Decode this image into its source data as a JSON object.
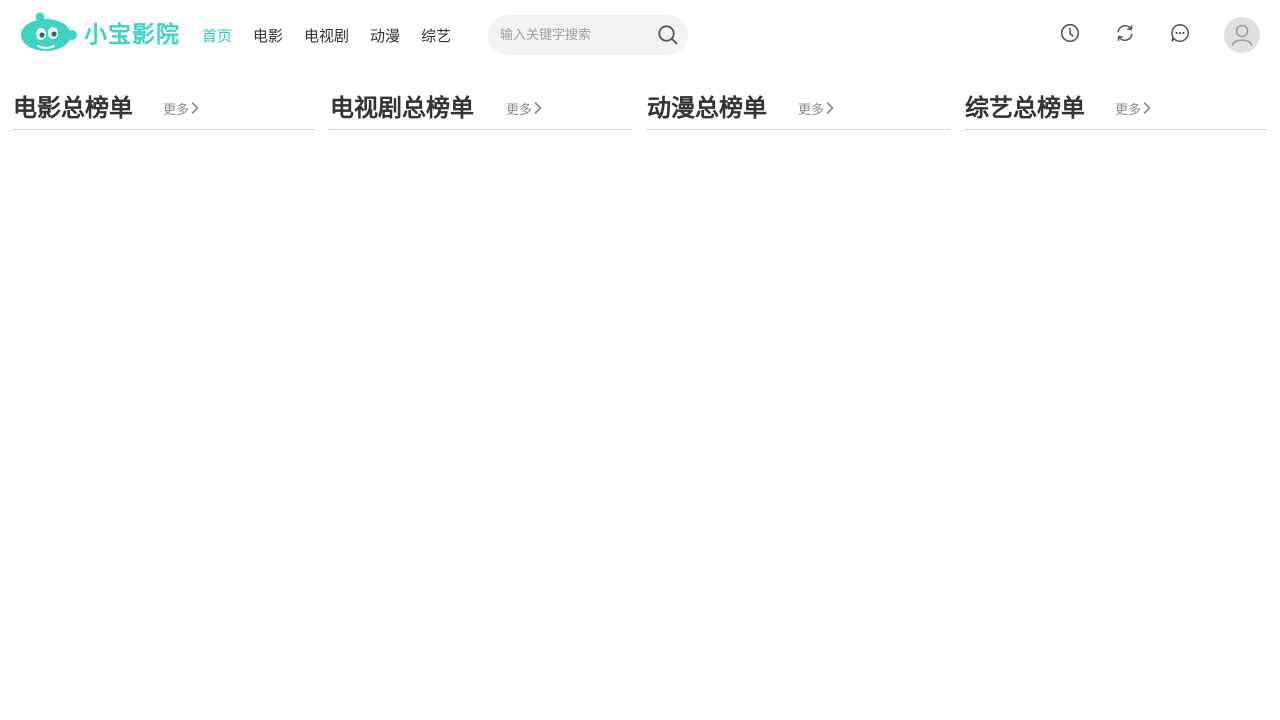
{
  "brand": {
    "name": "小宝影院",
    "accent_color": "#3fd3c4"
  },
  "nav": {
    "items": [
      {
        "label": "首页",
        "active": true
      },
      {
        "label": "电影",
        "active": false
      },
      {
        "label": "电视剧",
        "active": false
      },
      {
        "label": "动漫",
        "active": false
      },
      {
        "label": "综艺",
        "active": false
      }
    ]
  },
  "search": {
    "placeholder": "输入关键字搜索",
    "value": "",
    "icon": "search-icon"
  },
  "toolbar": {
    "history_icon": "clock-icon",
    "sync_icon": "refresh-icon",
    "message_icon": "chat-bubble-icon",
    "avatar_icon": "user-icon"
  },
  "rankings": {
    "more_label": "更多",
    "more_icon": "chevron-right-icon",
    "lists": [
      {
        "title": "电影总榜单"
      },
      {
        "title": "电视剧总榜单"
      },
      {
        "title": "动漫总榜单"
      },
      {
        "title": "综艺总榜单"
      }
    ]
  }
}
